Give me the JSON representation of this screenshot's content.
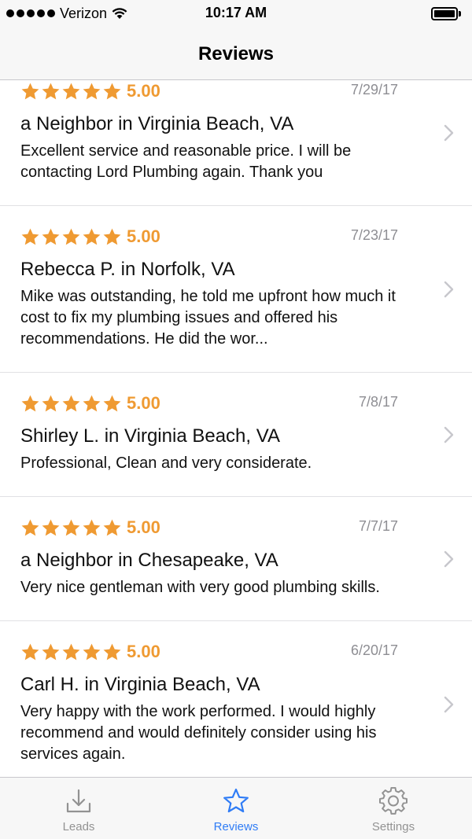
{
  "status_bar": {
    "carrier": "Verizon",
    "time": "10:17 AM"
  },
  "nav": {
    "title": "Reviews"
  },
  "colors": {
    "star": "#ef9a32",
    "accent": "#2f7cf6",
    "inactive": "#929292"
  },
  "reviews": [
    {
      "stars": 5,
      "rating": "5.00",
      "date": "7/29/17",
      "reviewer": "a Neighbor in Virginia Beach, VA",
      "text": "Excellent service and reasonable price. I will be contacting Lord Plumbing again.  Thank you"
    },
    {
      "stars": 5,
      "rating": "5.00",
      "date": "7/23/17",
      "reviewer": "Rebecca P. in Norfolk, VA",
      "text": "Mike was outstanding, he told me upfront how much it cost to fix my plumbing issues and offered his recommendations.  He did the wor..."
    },
    {
      "stars": 5,
      "rating": "5.00",
      "date": "7/8/17",
      "reviewer": "Shirley L. in Virginia Beach, VA",
      "text": "Professional, Clean and very considerate."
    },
    {
      "stars": 5,
      "rating": "5.00",
      "date": "7/7/17",
      "reviewer": "a Neighbor in Chesapeake, VA",
      "text": "Very nice gentleman with very good plumbing skills."
    },
    {
      "stars": 5,
      "rating": "5.00",
      "date": "6/20/17",
      "reviewer": "Carl H. in Virginia Beach, VA",
      "text": "Very happy with the work performed. I would highly recommend and would definitely consider using his services again."
    }
  ],
  "tabs": [
    {
      "label": "Leads",
      "icon": "download-tray-icon",
      "active": false
    },
    {
      "label": "Reviews",
      "icon": "star-outline-icon",
      "active": true
    },
    {
      "label": "Settings",
      "icon": "gear-icon",
      "active": false
    }
  ]
}
